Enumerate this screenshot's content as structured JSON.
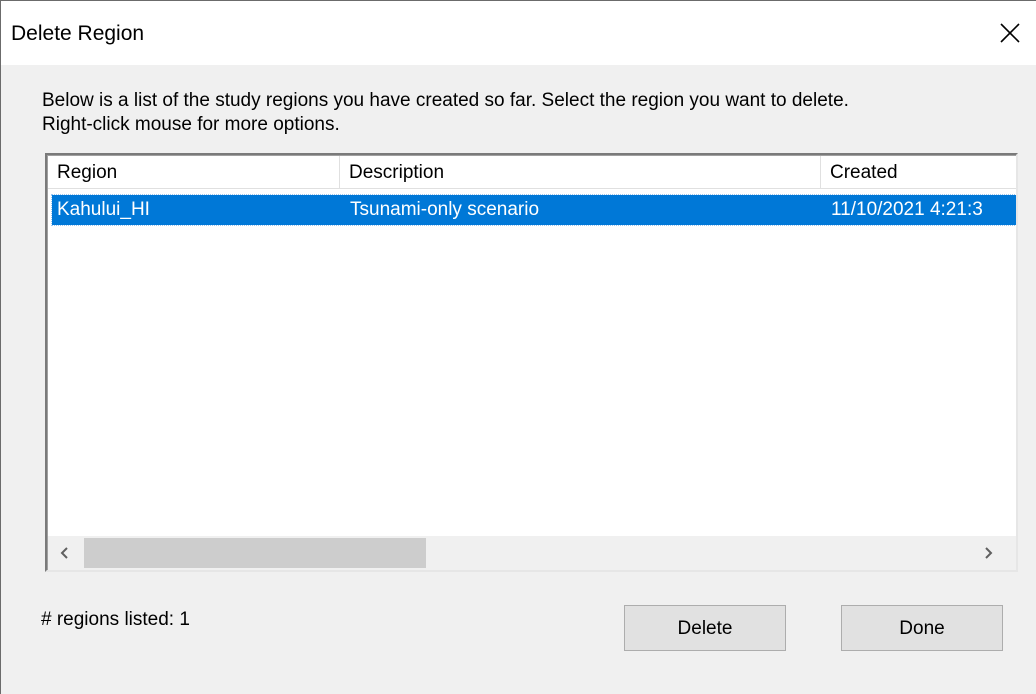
{
  "window": {
    "title": "Delete Region",
    "close_icon": "close-icon"
  },
  "instructions": {
    "line1": "Below is a list of the study regions you have created so far.  Select the region you want to delete.",
    "line2": "Right-click mouse for more options."
  },
  "table": {
    "columns": [
      "Region",
      "Description",
      "Created"
    ],
    "rows": [
      {
        "region": "Kahului_HI",
        "description": "Tsunami-only scenario",
        "created": "11/10/2021 4:21:3",
        "selected": true
      }
    ]
  },
  "status": {
    "regions_listed": "# regions listed: 1"
  },
  "buttons": {
    "delete": "Delete",
    "done": "Done"
  },
  "colors": {
    "selection": "#0078d7",
    "background": "#f0f0f0"
  }
}
